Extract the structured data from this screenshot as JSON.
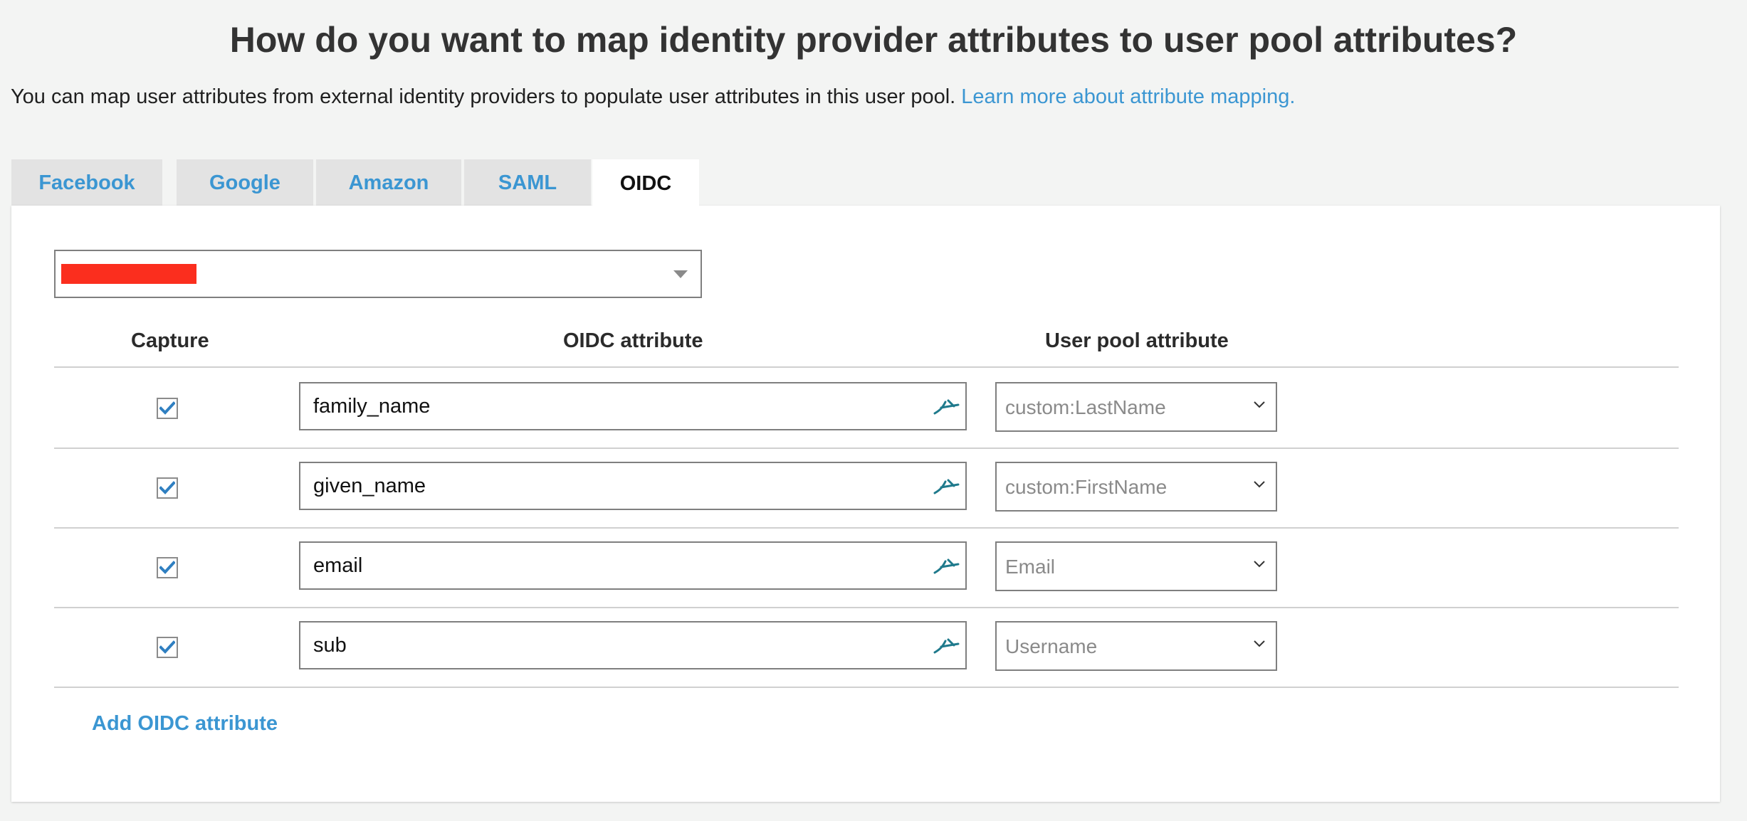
{
  "header": {
    "title": "How do you want to map identity provider attributes to user pool attributes?",
    "intro_text": "You can map user attributes from external identity providers to populate user attributes in this user pool.",
    "learn_more_link": "Learn more about attribute mapping."
  },
  "tabs": [
    {
      "label": "Facebook",
      "active": false
    },
    {
      "label": "Google",
      "active": false
    },
    {
      "label": "Amazon",
      "active": false
    },
    {
      "label": "SAML",
      "active": false
    },
    {
      "label": "OIDC",
      "active": true
    }
  ],
  "provider_select": {
    "value": "",
    "redacted": true,
    "redaction_color": "#fb2e1e"
  },
  "table": {
    "headers": {
      "capture": "Capture",
      "oidc_attribute": "OIDC attribute",
      "user_pool_attribute": "User pool attribute"
    },
    "rows": [
      {
        "capture": true,
        "oidc_attribute": "family_name",
        "user_pool_attribute": "custom:LastName"
      },
      {
        "capture": true,
        "oidc_attribute": "given_name",
        "user_pool_attribute": "custom:FirstName"
      },
      {
        "capture": true,
        "oidc_attribute": "email",
        "user_pool_attribute": "Email"
      },
      {
        "capture": true,
        "oidc_attribute": "sub",
        "user_pool_attribute": "Username"
      }
    ]
  },
  "actions": {
    "add_attribute_label": "Add OIDC attribute"
  },
  "colors": {
    "accent": "#3b96d2",
    "edit_icon": "#1f7a8c",
    "checkbox_check": "#2f7fc1"
  },
  "icons": {
    "row_edit": "pencil-edit-icon",
    "select_caret": "caret-down-icon",
    "pool_select": "chevron-down-icon",
    "checkbox": "checkmark-icon"
  }
}
